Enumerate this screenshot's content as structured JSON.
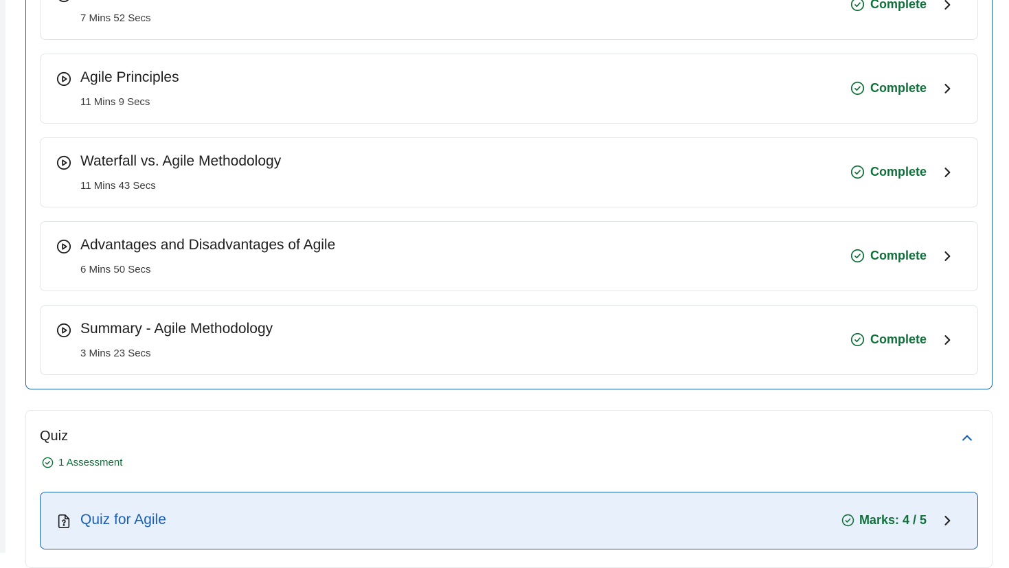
{
  "lessons": [
    {
      "title": "",
      "duration": "7 Mins 52 Secs",
      "status": "Complete"
    },
    {
      "title": "Agile Principles",
      "duration": "11 Mins 9 Secs",
      "status": "Complete"
    },
    {
      "title": "Waterfall vs. Agile Methodology",
      "duration": "11 Mins 43 Secs",
      "status": "Complete"
    },
    {
      "title": "Advantages and Disadvantages of Agile",
      "duration": "6 Mins 50 Secs",
      "status": "Complete"
    },
    {
      "title": "Summary - Agile Methodology",
      "duration": "3 Mins 23 Secs",
      "status": "Complete"
    }
  ],
  "quiz": {
    "section_title": "Quiz",
    "assessment_count": "1 Assessment",
    "item": {
      "title": "Quiz for Agile",
      "marks": "Marks: 4 / 5"
    }
  },
  "icons": {
    "lesson": "play-circle-icon",
    "status": "check-circle-icon",
    "row_action": "chevron-right-icon",
    "section_toggle": "chevron-up-icon",
    "quiz_item": "quiz-document-icon"
  },
  "colors": {
    "accent": "#1a5fb4",
    "success": "#11703a",
    "quiz_item_bg": "#e8f0fb"
  }
}
